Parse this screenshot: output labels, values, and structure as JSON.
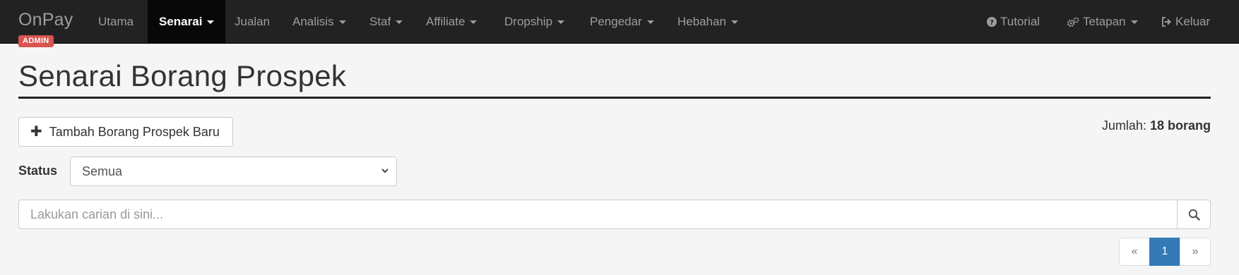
{
  "navbar": {
    "brand": "OnPay",
    "badge": "ADMIN",
    "items": [
      {
        "label": "Utama",
        "dropdown": false,
        "active": false
      },
      {
        "label": "Senarai",
        "dropdown": true,
        "active": true
      },
      {
        "label": "Jualan",
        "dropdown": false,
        "active": false
      },
      {
        "label": "Analisis",
        "dropdown": true,
        "active": false
      },
      {
        "label": "Staf",
        "dropdown": true,
        "active": false
      },
      {
        "label": "Affiliate",
        "dropdown": true,
        "active": false
      },
      {
        "label": "Dropship",
        "dropdown": true,
        "active": false
      },
      {
        "label": "Pengedar",
        "dropdown": true,
        "active": false
      },
      {
        "label": "Hebahan",
        "dropdown": true,
        "active": false
      }
    ],
    "right_items": [
      {
        "label": "Tutorial",
        "icon": "question-circle-icon",
        "dropdown": false
      },
      {
        "label": "Tetapan",
        "icon": "gears-icon",
        "dropdown": true
      },
      {
        "label": "Keluar",
        "icon": "sign-out-icon",
        "dropdown": false
      }
    ]
  },
  "page": {
    "title": "Senarai Borang Prospek",
    "add_button_label": "Tambah Borang Prospek Baru",
    "total_label": "Jumlah:",
    "total_value": "18 borang",
    "status_label": "Status",
    "status_selected": "Semua",
    "search_placeholder": "Lakukan carian di sini..."
  },
  "pagination": {
    "prev": "«",
    "current": "1",
    "next": "»"
  },
  "colors": {
    "navbar_bg": "#222222",
    "admin_badge": "#d9534f",
    "pagination_active": "#337ab7"
  }
}
